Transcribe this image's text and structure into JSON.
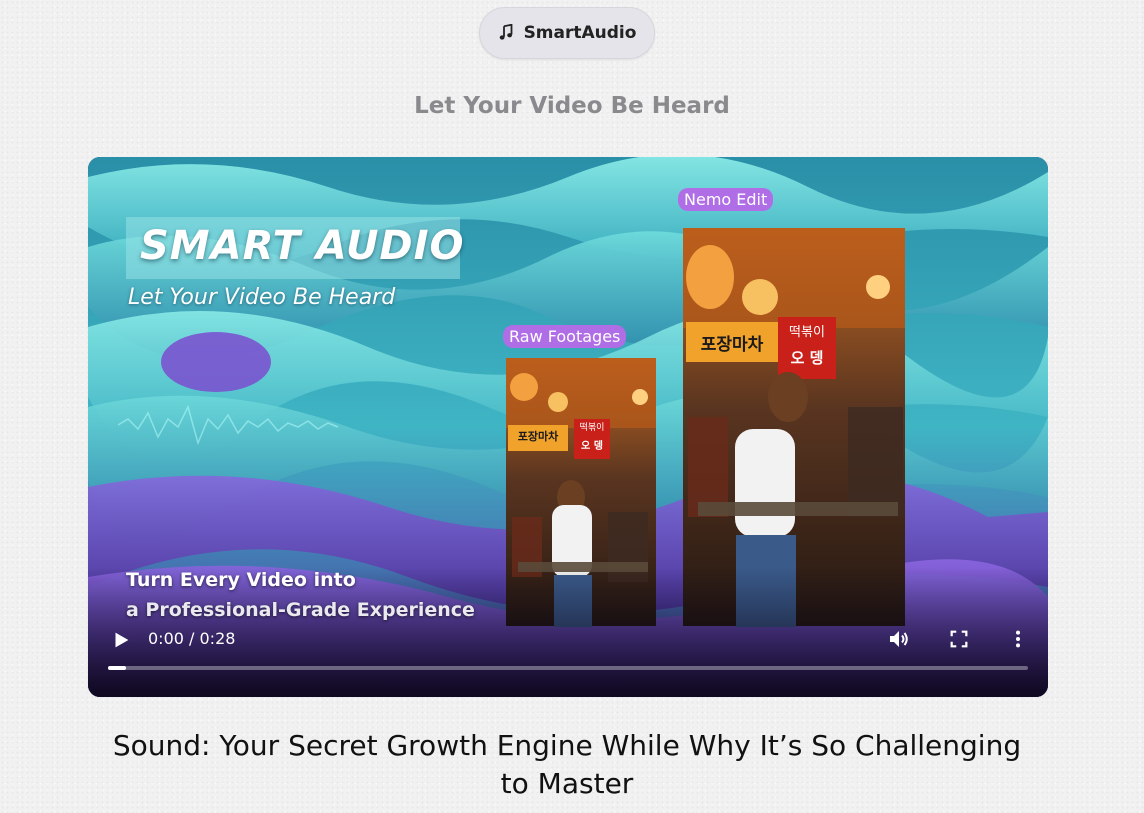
{
  "badge": {
    "icon": "music-note-icon",
    "label": "SmartAudio"
  },
  "tagline": "Let Your Video Be Heard",
  "video": {
    "title": "SMART AUDIO",
    "subtitle": "Let Your Video Be Heard",
    "label_edit": "Nemo Edit",
    "label_raw": "Raw Footages",
    "sign_left_1": "포장마차",
    "sign_left_2": "떡볶이",
    "sign_left_3": "오 뎅",
    "sign_right_1": "포장마차",
    "sign_right_2": "떡볶이",
    "sign_right_3": "오 뎅",
    "promo_line1": "Turn Every Video into",
    "promo_line2": "a Professional-Grade Experience",
    "time": "0:00 / 0:28",
    "progress": 0.02,
    "colors": {
      "accent_pill": "#b06ee6",
      "teal": "#5fd4d2",
      "purple": "#7a4fc8"
    }
  },
  "heading": "Sound: Your Secret Growth Engine While Why It’s So Challenging to Master"
}
